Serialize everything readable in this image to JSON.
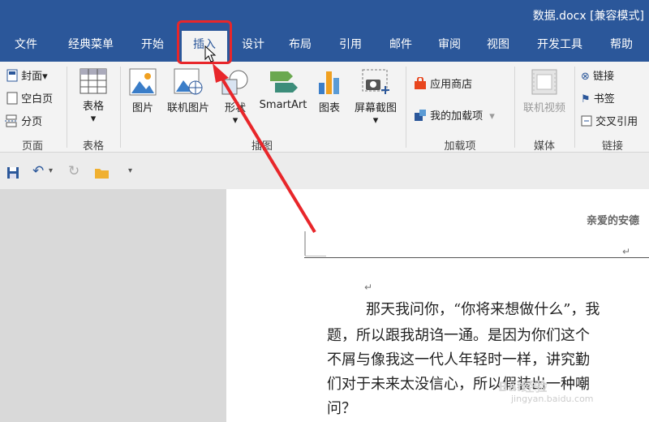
{
  "window": {
    "title": "数据.docx [兼容模式]"
  },
  "tabs": [
    "文件",
    "经典菜单",
    "开始",
    "插入",
    "设计",
    "布局",
    "引用",
    "邮件",
    "审阅",
    "视图",
    "开发工具",
    "帮助"
  ],
  "active_tab": "插入",
  "ribbon": {
    "pages": {
      "cover": "封面",
      "blank": "空白页",
      "break": "分页",
      "label": "页面"
    },
    "tables": {
      "table": "表格",
      "label": "表格"
    },
    "illustrations": {
      "picture": "图片",
      "online_picture": "联机图片",
      "shapes": "形状",
      "smartart": "SmartArt",
      "chart": "图表",
      "screenshot": "屏幕截图",
      "label": "插图"
    },
    "addins": {
      "store": "应用商店",
      "my_addins": "我的加载项",
      "label": "加载项"
    },
    "media": {
      "online_video": "联机视频",
      "label": "媒体"
    },
    "links": {
      "link": "链接",
      "bookmark": "书签",
      "cross_ref": "交叉引用",
      "label": "链接"
    }
  },
  "document": {
    "header_text": "亲爱的安德",
    "lines": [
      "那天我问你，“你将来想做什么”，我",
      "题，所以跟我胡诌一通。是因为你们这个",
      "不屑与像我这一代人年轻时一样，讲究勤",
      "们对于未来太没信心，所以假装出一种嘲",
      "问？"
    ]
  },
  "watermark": {
    "text": "Bai经验",
    "url": "jingyan.baidu.com"
  },
  "colors": {
    "accent": "#2b579a",
    "highlight": "#e8262a"
  }
}
